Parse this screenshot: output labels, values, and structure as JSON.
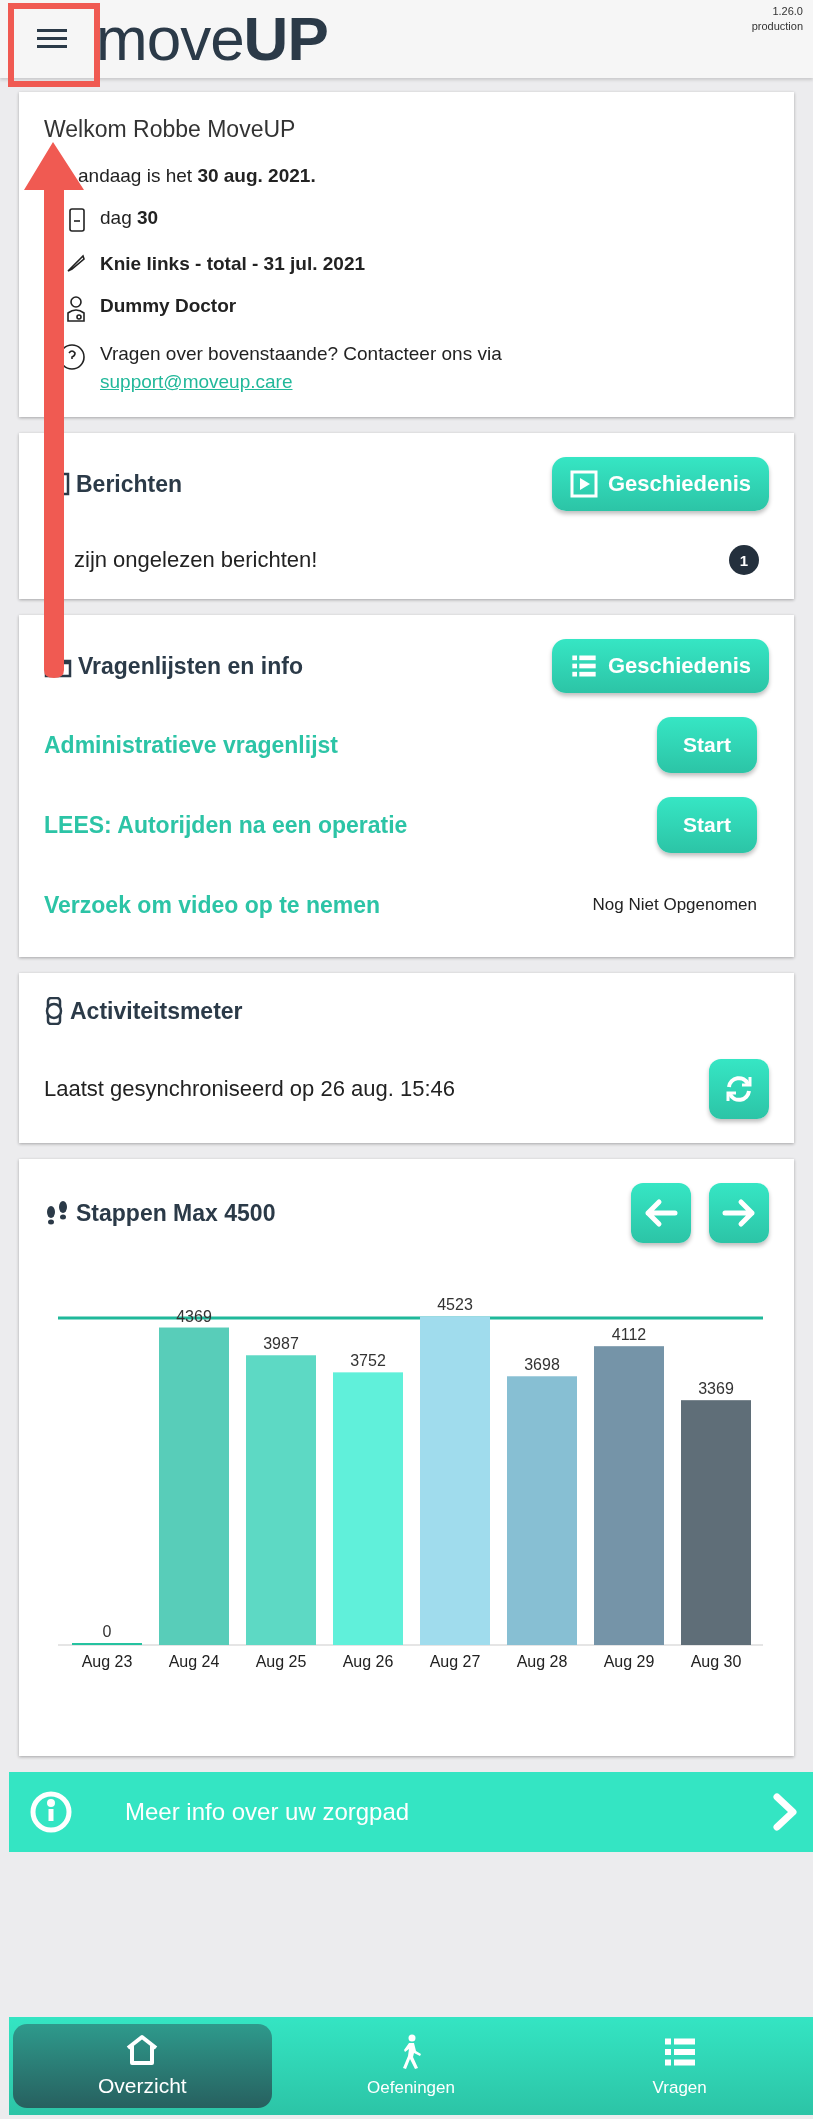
{
  "header": {
    "logo_light": "move",
    "logo_bold": "UP",
    "version": "1.26.0",
    "environment": "production"
  },
  "welcome": {
    "title": "Welkom Robbe MoveUP",
    "date_line": "andaag is het **30 aug. 2021.**",
    "details": [
      {
        "kind": "calendar",
        "text": "dag **30**",
        "bold": false
      },
      {
        "kind": "surgery",
        "text": "Knie links - total - 31 jul. 2021",
        "bold": true
      },
      {
        "kind": "doctor",
        "text": "Dummy Doctor",
        "bold": true
      },
      {
        "kind": "help",
        "text": "Vragen over bovenstaande? Contacteer ons via",
        "bold": false,
        "link": "support@moveup.care"
      }
    ]
  },
  "messages": {
    "title": "Berichten",
    "history_button": "Geschiedenis",
    "notice": "zijn ongelezen berichten!",
    "unread_count": "1"
  },
  "questionnaires": {
    "title": "Vragenlijsten en info",
    "history_button": "Geschiedenis",
    "items": [
      {
        "kind": "button",
        "title": "Administratieve vragenlijst",
        "action": "Start"
      },
      {
        "kind": "button",
        "title": "LEES: Autorijden na een operatie",
        "action": "Start"
      },
      {
        "kind": "status",
        "title": "Verzoek om video op te nemen",
        "status": "Nog Niet Opgenomen"
      }
    ]
  },
  "activity": {
    "title": "Activiteitsmeter",
    "sync_text": "Laatst gesynchroniseerd op 26 aug. 15:46"
  },
  "steps": {
    "title": "Stappen Max 4500",
    "chart_data": {
      "type": "bar",
      "categories": [
        "Aug 23",
        "Aug 24",
        "Aug 25",
        "Aug 26",
        "Aug 27",
        "Aug 28",
        "Aug 29",
        "Aug 30"
      ],
      "values": [
        0,
        4369,
        3987,
        3752,
        4523,
        3698,
        4112,
        3369
      ],
      "data_labels": true
    }
  },
  "info_bar": {
    "text": "Meer info over uw zorgpad"
  },
  "nav": [
    {
      "kind": "home",
      "label": "Overzicht",
      "selected": true
    },
    {
      "kind": "walk",
      "label": "Oefeningen",
      "selected": false
    },
    {
      "kind": "list",
      "label": "Vragen",
      "selected": false
    }
  ]
}
